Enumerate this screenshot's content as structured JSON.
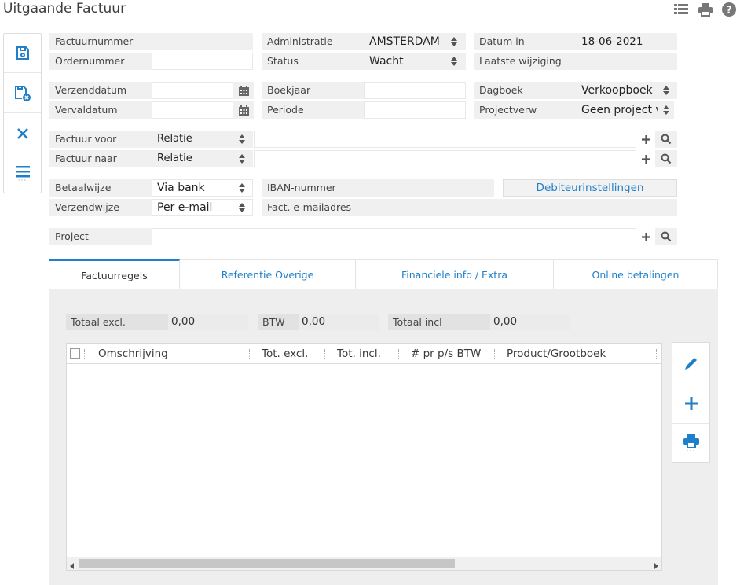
{
  "header": {
    "title": "Uitgaande Factuur",
    "icons": [
      "list-view-icon",
      "print-icon",
      "help-icon"
    ]
  },
  "sidebar": {
    "actions": [
      "save-icon",
      "save-close-icon",
      "close-icon",
      "menu-icon"
    ]
  },
  "form": {
    "factuurnummer": {
      "label": "Factuurnummer",
      "value": ""
    },
    "ordernummer": {
      "label": "Ordernummer",
      "value": ""
    },
    "administratie": {
      "label": "Administratie",
      "value": "AMSTERDAM"
    },
    "status": {
      "label": "Status",
      "value": "Wacht"
    },
    "datum_in": {
      "label": "Datum in",
      "value": "18-06-2021"
    },
    "laatste_wijziging": {
      "label": "Laatste wijziging",
      "value": ""
    },
    "verzenddatum": {
      "label": "Verzenddatum",
      "value": ""
    },
    "vervaldatum": {
      "label": "Vervaldatum",
      "value": ""
    },
    "boekjaar": {
      "label": "Boekjaar",
      "value": ""
    },
    "periode": {
      "label": "Periode",
      "value": ""
    },
    "dagboek": {
      "label": "Dagboek",
      "value": "Verkoopboek"
    },
    "projectverw": {
      "label": "Projectverw",
      "value": "Geen project ve"
    },
    "factuur_voor": {
      "label": "Factuur voor",
      "type": "Relatie",
      "value": ""
    },
    "factuur_naar": {
      "label": "Factuur naar",
      "type": "Relatie",
      "value": ""
    },
    "betaalwijze": {
      "label": "Betaalwijze",
      "value": "Via bank"
    },
    "verzendwijze": {
      "label": "Verzendwijze",
      "value": "Per e-mail"
    },
    "iban": {
      "label": "IBAN-nummer",
      "value": ""
    },
    "fact_email": {
      "label": "Fact. e-mailadres",
      "value": ""
    },
    "debiteur_button": "Debiteurinstellingen",
    "project": {
      "label": "Project",
      "value": ""
    }
  },
  "tabs": [
    {
      "label": "Factuurregels",
      "active": true
    },
    {
      "label": "Referentie Overige",
      "active": false
    },
    {
      "label": "Financiele info / Extra",
      "active": false
    },
    {
      "label": "Online betalingen",
      "active": false
    }
  ],
  "totals": {
    "excl": {
      "label": "Totaal excl.",
      "value": "0,00"
    },
    "btw": {
      "label": "BTW",
      "value": "0,00"
    },
    "incl": {
      "label": "Totaal incl",
      "value": "0,00"
    }
  },
  "grid": {
    "columns": [
      "Omschrijving",
      "Tot. excl.",
      "Tot. incl.",
      "# pr p/s BTW",
      "Product/Grootboek"
    ],
    "rows": []
  },
  "colors": {
    "accent": "#1f7fc8",
    "label_bg": "#f0f0f0",
    "panel_bg": "#eeeeee"
  }
}
